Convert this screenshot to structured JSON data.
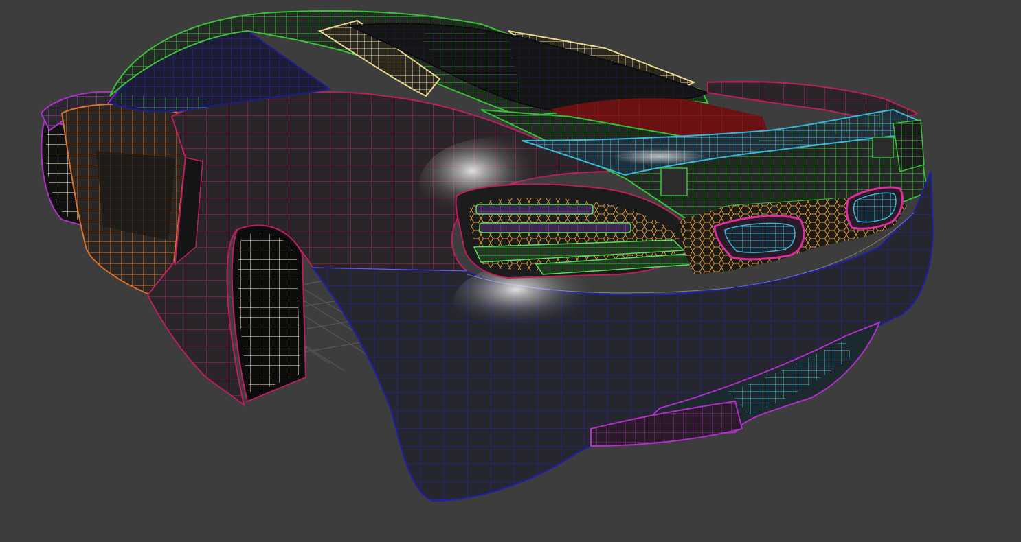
{
  "viewport": {
    "background": "#3d3d3d",
    "subject": "sports-car-wireframe-rear-three-quarter",
    "shading_mode": "shaded-with-wireframe-overlay"
  },
  "colors": {
    "body_shell": "#2a2a2d",
    "rear_bumper_wire": "#1e1ea8",
    "rear_quarter_wire": "#b0205a",
    "side_intake_wire": "#d8742a",
    "roof_wire": "#3ac03a",
    "glass_wire": "#1c1c8c",
    "engine_cover_wire": "#e8d890",
    "spoiler_wire": "#3ab8d8",
    "diffuser_wire": "#3ab8d8",
    "tail_light_wire": "#5ae05a",
    "mesh_grille_wire": "#d89a3a",
    "exhaust_wire": "#d8309a",
    "wheel_arch_wire": "#f0e8c8",
    "left_edge_wire": "#b030c8",
    "red_panel": "#b01818",
    "ground_grid": "#6a6a6a"
  }
}
